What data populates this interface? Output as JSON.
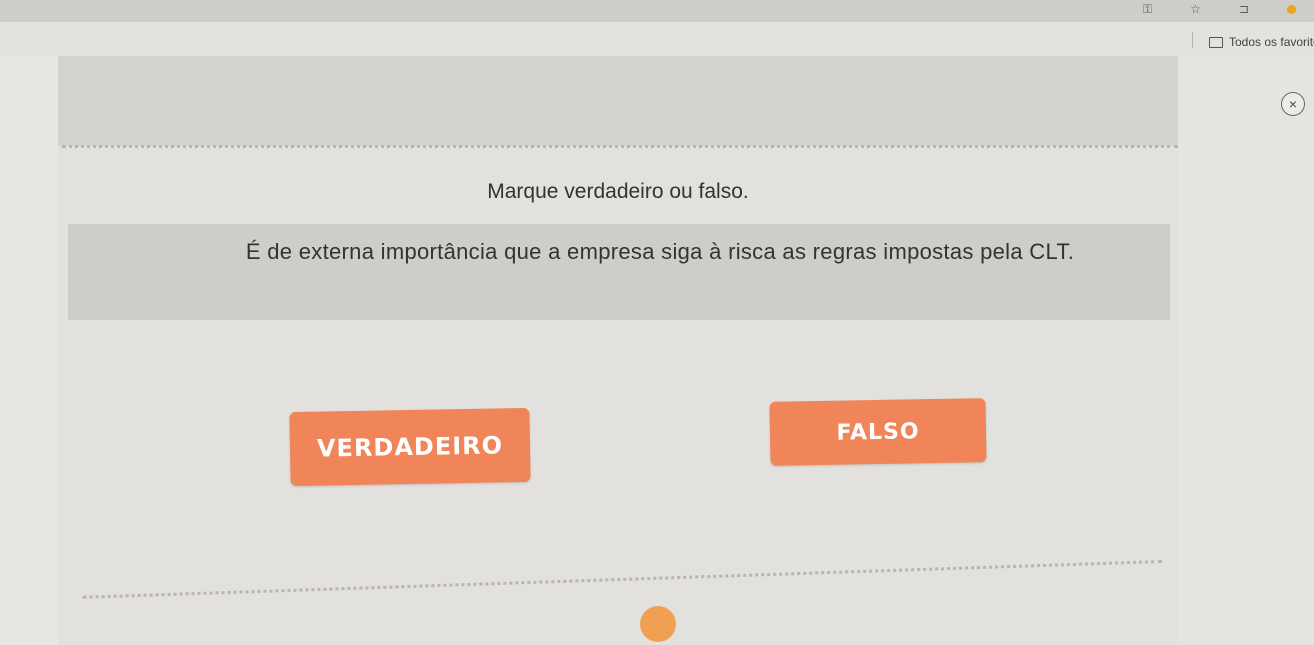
{
  "browser": {
    "bookmarks_folder_label": "Todos os favorito",
    "icons": [
      "key-icon",
      "star-icon",
      "sidebar-icon",
      "profile-icon"
    ]
  },
  "quiz": {
    "close_symbol": "×",
    "instruction": "Marque verdadeiro ou falso.",
    "statement": "É de externa importância que a empresa siga à risca as regras impostas pela CLT.",
    "buttons": {
      "true_label": "VERDADEIRO",
      "false_label": "FALSO"
    }
  },
  "colors": {
    "button_bg": "#f08559",
    "progress_dot": "#f0a050",
    "modal_bg": "#e3e1dd"
  }
}
